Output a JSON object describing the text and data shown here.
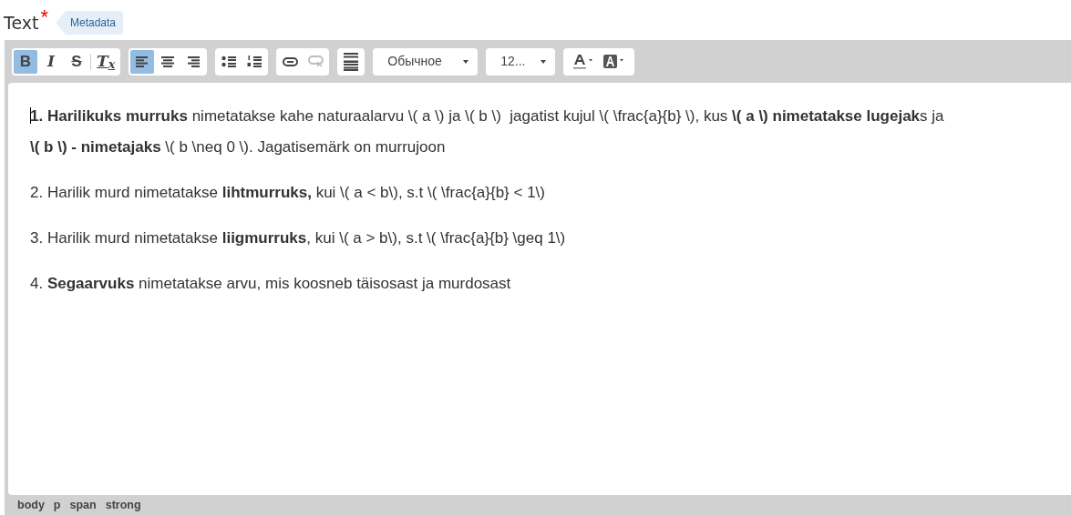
{
  "field": {
    "label": "Text",
    "required_mark": "*",
    "tag": "Metadata"
  },
  "toolbar": {
    "groups": [
      {
        "buttons": [
          {
            "kind": "bold",
            "label": "B",
            "active": true,
            "disabled": false
          },
          {
            "kind": "italic",
            "label": "I",
            "active": false,
            "disabled": false
          },
          {
            "kind": "strike",
            "label": "S",
            "active": false,
            "disabled": false
          },
          {
            "kind": "separator"
          },
          {
            "kind": "removeformat",
            "label": "T$_{x}$",
            "active": false,
            "disabled": false
          }
        ]
      },
      {
        "buttons": [
          {
            "kind": "align-left",
            "active": true,
            "disabled": false
          },
          {
            "kind": "align-center",
            "active": false,
            "disabled": false
          },
          {
            "kind": "align-right",
            "active": false,
            "disabled": false
          }
        ]
      },
      {
        "buttons": [
          {
            "kind": "bullets",
            "active": false,
            "disabled": false
          },
          {
            "kind": "numbers",
            "active": false,
            "disabled": false
          }
        ]
      },
      {
        "buttons": [
          {
            "kind": "link",
            "active": false,
            "disabled": false
          },
          {
            "kind": "unlink",
            "active": false,
            "disabled": true
          }
        ]
      },
      {
        "buttons": [
          {
            "kind": "hr",
            "active": false,
            "disabled": false
          }
        ]
      }
    ],
    "combos": [
      {
        "value": "Обычное"
      },
      {
        "value": "12..."
      }
    ],
    "colors": [
      {
        "kind": "text-color"
      },
      {
        "kind": "bg-color"
      }
    ]
  },
  "content": {
    "paragraphs": [
      "**1. Harilikuks murruks** nimetatakse kahe naturaalarvu \\( a \\) ja \\( b \\)  jagatist kujul \\( \\frac{a}{b} \\), kus **\\( a \\) nimetatakse lugejak**s ja **\\( b \\) - nimetajaks** \\( b \\neq 0 \\). Jagatisemärk on murrujoon",
      "2. Harilik murd nimetatakse **lihtmurruks,** kui \\( a < b\\), s.t \\( \\frac{a}{b} < 1\\)",
      "3. Harilik murd nimetatakse **liigmurruks**, kui \\( a > b\\), s.t \\( \\frac{a}{b} \\geq 1\\)",
      "4. **Segaarvuks** nimetatakse arvu, mis koosneb täisosast ja murdosast"
    ]
  },
  "status_bar": {
    "path": [
      "body",
      "p",
      "span",
      "strong"
    ]
  }
}
